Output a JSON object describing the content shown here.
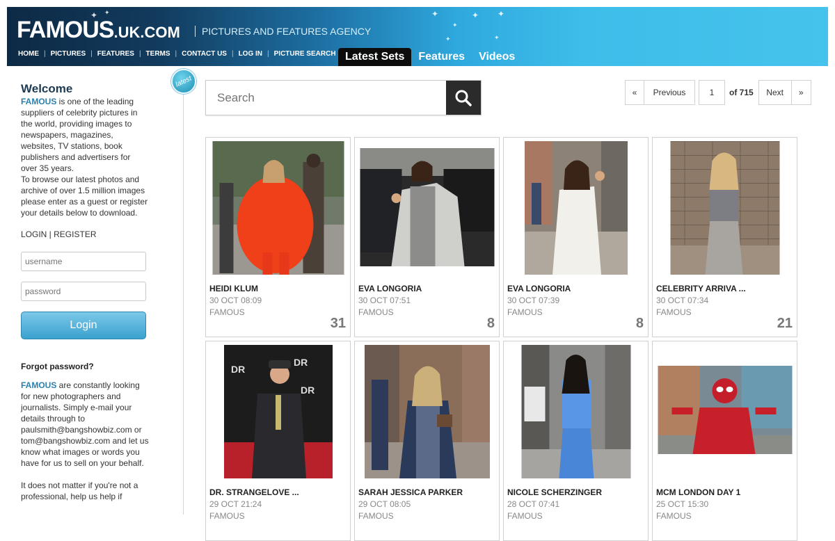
{
  "header": {
    "logo_main": "FAMOUS",
    "logo_domain": ".UK.COM",
    "tagline": "PICTURES AND FEATURES AGENCY",
    "nav": [
      "HOME",
      "PICTURES",
      "FEATURES",
      "TERMS",
      "CONTACT US",
      "LOG IN",
      "PICTURE SEARCH"
    ],
    "tabs": [
      {
        "label": "Latest Sets",
        "active": true
      },
      {
        "label": "Features",
        "active": false
      },
      {
        "label": "Videos",
        "active": false
      }
    ]
  },
  "sidebar": {
    "welcome": "Welcome",
    "brand": "FAMOUS",
    "intro": " is one of the leading suppliers of celebrity pictures in the world, providing images to newspapers, magazines, websites, TV stations, book publishers and advertisers for over 35 years.",
    "browse": "To browse our latest photos and archive of over 1.5 million images please enter as a guest or register your details below to download.",
    "login_link": "LOGIN",
    "register_link": "REGISTER",
    "username_placeholder": "username",
    "password_placeholder": "password",
    "login_button": "Login",
    "forgot": "Forgot password?",
    "recruit": " are constantly looking for new photographers and journalists. Simply e-mail your details through to paulsmith@bangshowbiz.com or tom@bangshowbiz.com and let us know what images or words you have for us to sell on your behalf.",
    "footer_text": "It does not matter if you're not a professional, help us help if"
  },
  "badge": "latest",
  "search": {
    "placeholder": "Search"
  },
  "pager": {
    "first": "«",
    "prev": "Previous",
    "page": "1",
    "of": "of 715",
    "next": "Next",
    "last": "»"
  },
  "colors": {
    "accent": "#2a7fb0",
    "header_dark": "#0d2a45",
    "header_light": "#45c3ec"
  },
  "cards": [
    {
      "title": "HEIDI KLUM",
      "date": "30 OCT 08:09",
      "source": "FAMOUS",
      "count": "31"
    },
    {
      "title": "EVA LONGORIA",
      "date": "30 OCT 07:51",
      "source": "FAMOUS",
      "count": "8"
    },
    {
      "title": "EVA LONGORIA",
      "date": "30 OCT 07:39",
      "source": "FAMOUS",
      "count": "8"
    },
    {
      "title": "CELEBRITY ARRIVA ...",
      "date": "30 OCT 07:34",
      "source": "FAMOUS",
      "count": "21"
    },
    {
      "title": "DR. STRANGELOVE ...",
      "date": "29 OCT 21:24",
      "source": "FAMOUS",
      "count": ""
    },
    {
      "title": "SARAH JESSICA PARKER",
      "date": "29 OCT 08:05",
      "source": "FAMOUS",
      "count": ""
    },
    {
      "title": "NICOLE SCHERZINGER",
      "date": "28 OCT 07:41",
      "source": "FAMOUS",
      "count": ""
    },
    {
      "title": "MCM LONDON DAY 1",
      "date": "25 OCT 15:30",
      "source": "FAMOUS",
      "count": ""
    }
  ]
}
